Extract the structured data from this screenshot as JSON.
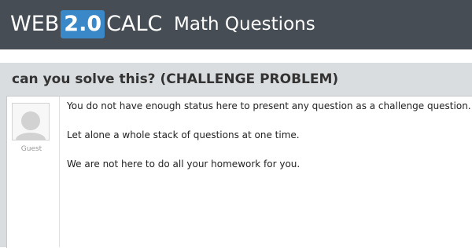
{
  "header": {
    "logo_prefix": "WEB",
    "logo_badge": "2.0",
    "logo_suffix": "CALC",
    "section_title": "Math Questions"
  },
  "question": {
    "title": "can you solve this? (CHALLENGE PROBLEM)"
  },
  "answer": {
    "username": "Guest",
    "paragraphs": [
      "You do not have enough status here to present any question as a challenge question.",
      "Let alone a whole stack of questions at one time.",
      "We are not here to do all your homework for you."
    ]
  },
  "colors": {
    "header_bg": "#464d54",
    "logo_badge_bg": "#3b88c9",
    "content_bg": "#dadddf"
  }
}
